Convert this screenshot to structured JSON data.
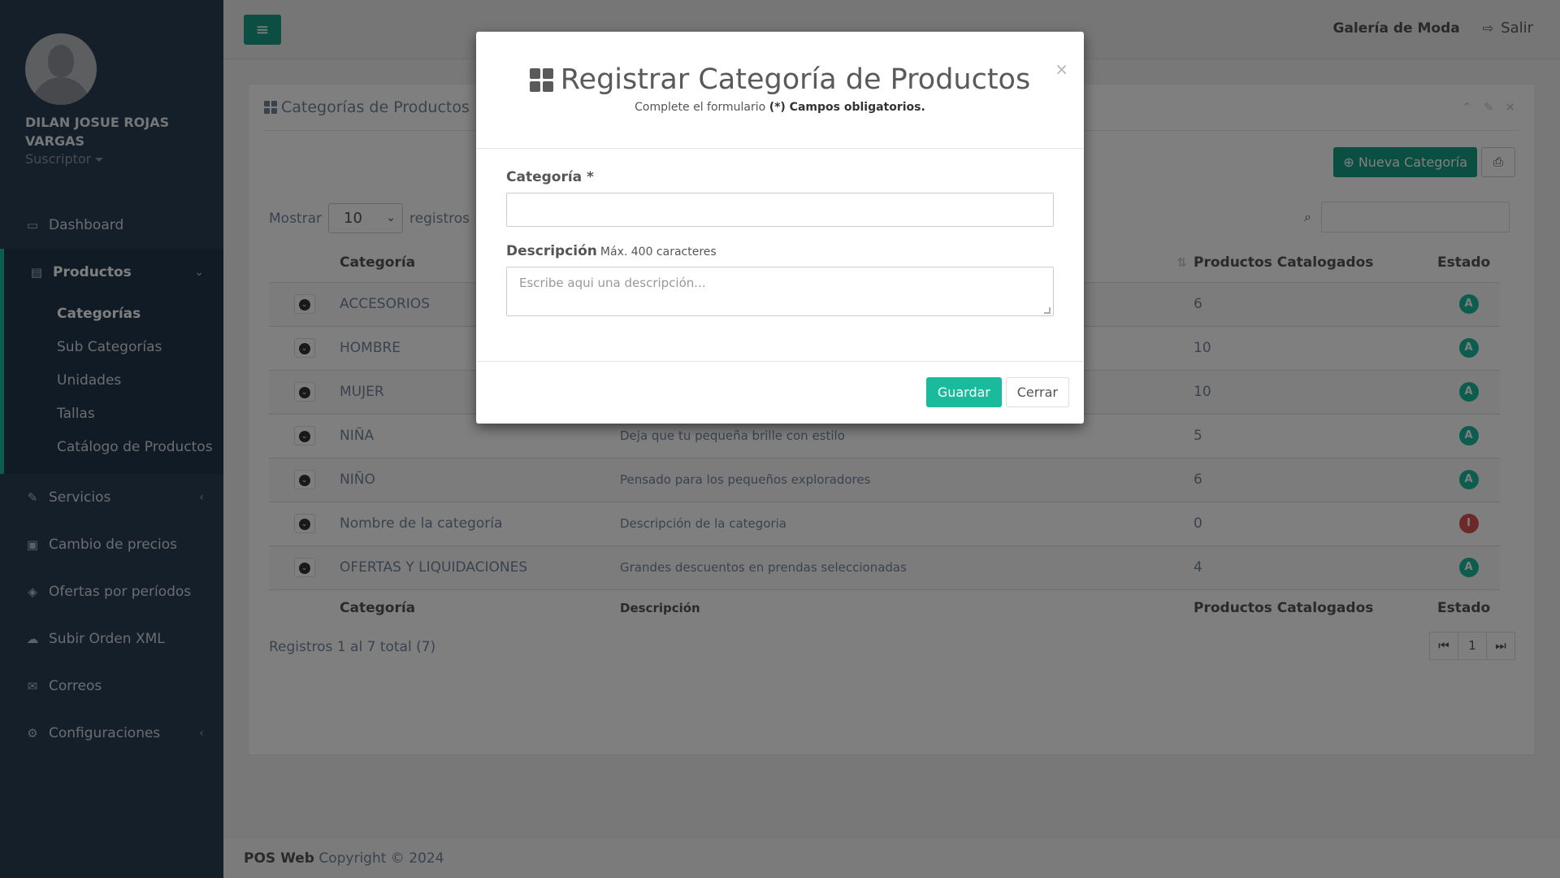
{
  "user": {
    "name": "DILAN JOSUE ROJAS VARGAS",
    "role": "Suscriptor"
  },
  "sidebar": {
    "items": [
      {
        "label": "Dashboard",
        "icon": "laptop-icon"
      },
      {
        "label": "Productos",
        "icon": "archive-icon"
      },
      {
        "label": "Servicios",
        "icon": "wrench-icon"
      },
      {
        "label": "Cambio de precios",
        "icon": "money-icon"
      },
      {
        "label": "Ofertas por períodos",
        "icon": "tags-icon"
      },
      {
        "label": "Subir Orden XML",
        "icon": "cloud-upload-icon"
      },
      {
        "label": "Correos",
        "icon": "envelope-icon"
      },
      {
        "label": "Configuraciones",
        "icon": "cogs-icon"
      }
    ],
    "submenu": [
      "Categorías",
      "Sub Categorías",
      "Unidades",
      "Tallas",
      "Catálogo de Productos"
    ]
  },
  "topnav": {
    "shop": "Galería de Moda",
    "logout": "Salir"
  },
  "panel": {
    "title": "Categorías de Productos",
    "new_button": "Nueva Categoría",
    "show_label": "Mostrar",
    "show_value": "10",
    "records_label": "registros"
  },
  "table": {
    "headers": {
      "category": "Categoría",
      "description": "Descripción",
      "products": "Productos Catalogados",
      "status": "Estado"
    },
    "rows": [
      {
        "category": "ACCESORIOS",
        "description": "",
        "products": "6",
        "status": "A"
      },
      {
        "category": "HOMBRE",
        "description": "",
        "products": "10",
        "status": "A"
      },
      {
        "category": "MUJER",
        "description": "",
        "products": "10",
        "status": "A"
      },
      {
        "category": "NIÑA",
        "description": "Deja que tu pequeña brille con estilo",
        "products": "5",
        "status": "A"
      },
      {
        "category": "NIÑO",
        "description": "Pensado para los pequeños exploradores",
        "products": "6",
        "status": "A"
      },
      {
        "category": "Nombre de la categoría",
        "description": "Descripción de la categoria",
        "products": "0",
        "status": "I"
      },
      {
        "category": "OFERTAS Y LIQUIDACIONES",
        "description": "Grandes descuentos en prendas seleccionadas",
        "products": "4",
        "status": "A"
      }
    ],
    "info": "Registros 1 al 7 total (7)",
    "page": "1"
  },
  "footer": {
    "brand": "POS Web",
    "copyright": "Copyright © 2024"
  },
  "modal": {
    "title": "Registrar Categoría de Productos",
    "subtitle_prefix": "Complete el formulario",
    "subtitle_bold": "(*) Campos obligatorios.",
    "category_label": "Categoría *",
    "description_label": "Descripción",
    "description_hint": "Máx. 400 caracteres",
    "description_placeholder": "Escribe aqui una descripción...",
    "save_button": "Guardar",
    "close_button": "Cerrar"
  },
  "colors": {
    "sidebar": "#2a3f54",
    "accent": "#169f85",
    "active_badge": "#1abb9c",
    "inactive_badge": "#d9534f"
  }
}
